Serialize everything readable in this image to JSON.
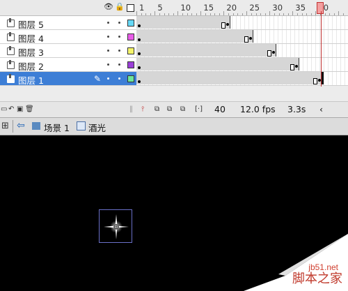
{
  "timeline": {
    "ruler_numbers": [
      "1",
      "5",
      "10",
      "15",
      "20",
      "25",
      "30",
      "35",
      "40"
    ],
    "layers": [
      {
        "label": "图层 5",
        "color": "#66d9f7",
        "tween_end_frame": 20,
        "selected": false
      },
      {
        "label": "图层 4",
        "color": "#e85ce8",
        "tween_end_frame": 25,
        "selected": false
      },
      {
        "label": "图层 3",
        "color": "#f4f46a",
        "tween_end_frame": 30,
        "selected": false
      },
      {
        "label": "图层 2",
        "color": "#9b3fd8",
        "tween_end_frame": 35,
        "selected": false
      },
      {
        "label": "图层 1",
        "color": "#6de59a",
        "tween_end_frame": 40,
        "selected": true
      }
    ],
    "current_frame": "40",
    "fps": "12.0 fps",
    "elapsed": "3.3s"
  },
  "editbar": {
    "scene_label": "场景 1",
    "symbol_label": "酒光"
  },
  "watermark": {
    "site": "jb51.net",
    "name": "脚本之家"
  }
}
